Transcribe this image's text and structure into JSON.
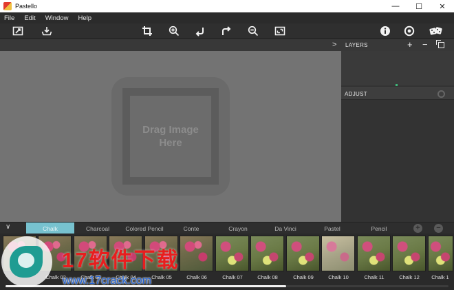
{
  "window": {
    "title": "Pastello",
    "controls": {
      "minimize": "—",
      "maximize": "☐",
      "close": "✕"
    }
  },
  "menu": [
    "File",
    "Edit",
    "Window",
    "Help"
  ],
  "toolbar": {
    "left": [
      "open-image-icon",
      "save-image-icon"
    ],
    "center": [
      "crop-icon",
      "zoom-in-icon",
      "undo-icon",
      "redo-icon",
      "zoom-out-icon",
      "fit-screen-icon"
    ],
    "right": [
      "info-icon",
      "settings-icon",
      "random-dice-icon"
    ]
  },
  "panels": {
    "collapse_arrow": ">",
    "layers": {
      "label": "LAYERS",
      "add": "+",
      "remove": "−"
    },
    "adjust": {
      "label": "ADJUST"
    }
  },
  "canvas": {
    "placeholder": "Drag Image Here"
  },
  "styles": {
    "chevron": "∨",
    "tabs": [
      "Chalk",
      "Charcoal",
      "Colored Pencil",
      "Conte",
      "Crayon",
      "Da Vinci",
      "Pastel",
      "Pencil"
    ],
    "active": "Chalk",
    "add": "+",
    "remove": "−"
  },
  "presets": [
    "Chalk 02",
    "Chalk 03",
    "Chalk 04",
    "Chalk 05",
    "Chalk 06",
    "Chalk 07",
    "Chalk 08",
    "Chalk 09",
    "Chalk 10",
    "Chalk 11",
    "Chalk 12",
    "Chalk 1"
  ],
  "presets_scroll": {
    "position_fraction": 0.63
  },
  "watermark": {
    "brand": "17软件下载",
    "url": "www.17crack.com"
  },
  "colors": {
    "accent": "#77c2cf",
    "canvas": "#737373",
    "panel": "#333333"
  }
}
